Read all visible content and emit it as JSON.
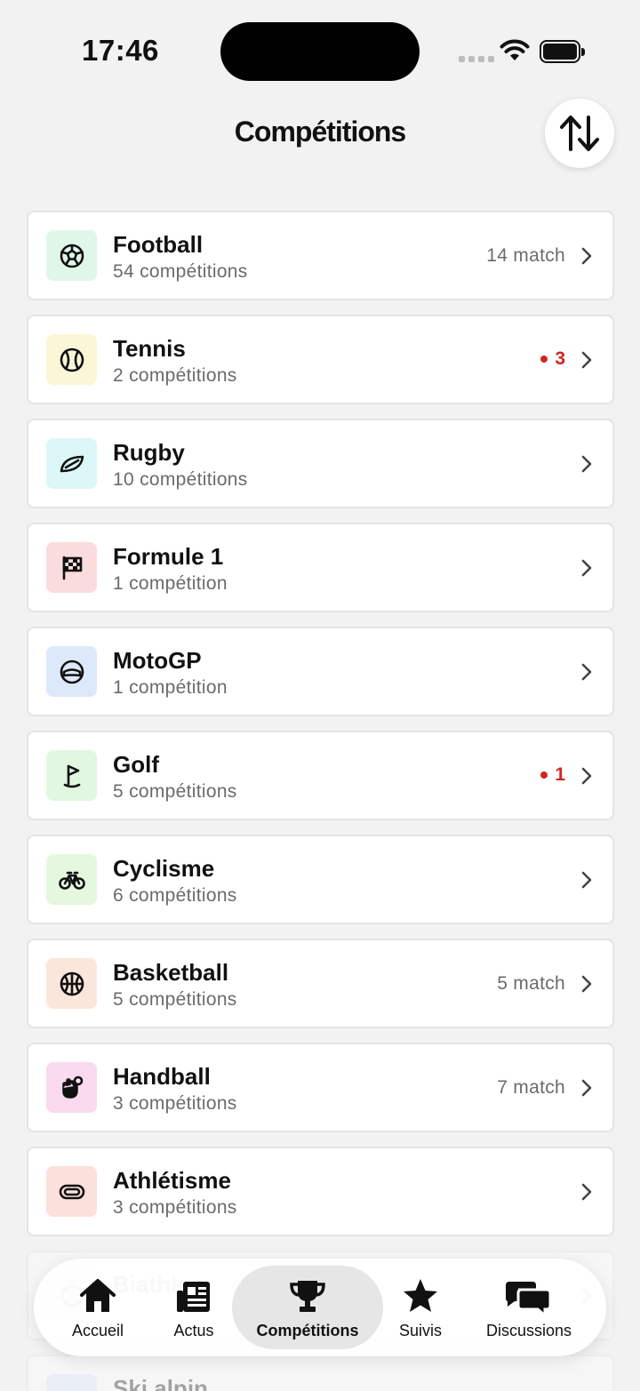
{
  "status_bar": {
    "time": "17:46"
  },
  "header": {
    "title": "Compétitions"
  },
  "competitions": [
    {
      "name": "Football",
      "subtitle": "54 compétitions",
      "right": "14 match",
      "live": null,
      "icon": "soccer-ball-icon",
      "bg": "#dff7e8"
    },
    {
      "name": "Tennis",
      "subtitle": "2 compétitions",
      "right": null,
      "live": "3",
      "icon": "tennis-ball-icon",
      "bg": "#fbf6d6"
    },
    {
      "name": "Rugby",
      "subtitle": "10 compétitions",
      "right": null,
      "live": null,
      "icon": "rugby-ball-icon",
      "bg": "#dcf7f7"
    },
    {
      "name": "Formule 1",
      "subtitle": "1 compétition",
      "right": null,
      "live": null,
      "icon": "checkered-flag-icon",
      "bg": "#fbdcdc"
    },
    {
      "name": "MotoGP",
      "subtitle": "1 compétition",
      "right": null,
      "live": null,
      "icon": "helmet-icon",
      "bg": "#dde9fb"
    },
    {
      "name": "Golf",
      "subtitle": "5 compétitions",
      "right": null,
      "live": "1",
      "icon": "golf-flag-icon",
      "bg": "#e1f7df"
    },
    {
      "name": "Cyclisme",
      "subtitle": "6 compétitions",
      "right": null,
      "live": null,
      "icon": "bicycle-icon",
      "bg": "#e5f8df"
    },
    {
      "name": "Basketball",
      "subtitle": "5 compétitions",
      "right": "5 match",
      "live": null,
      "icon": "basketball-icon",
      "bg": "#fbe6db"
    },
    {
      "name": "Handball",
      "subtitle": "3 compétitions",
      "right": "7 match",
      "live": null,
      "icon": "hand-ball-icon",
      "bg": "#f9daee"
    },
    {
      "name": "Athlétisme",
      "subtitle": "3 compétitions",
      "right": null,
      "live": null,
      "icon": "track-icon",
      "bg": "#fbe0db"
    },
    {
      "name": "Biathlon",
      "subtitle": "",
      "right": null,
      "live": null,
      "icon": "biathlon-icon",
      "bg": "#dde9fb"
    },
    {
      "name": "Ski alpin",
      "subtitle": "",
      "right": null,
      "live": null,
      "icon": "ski-icon",
      "bg": "#dde9fb"
    }
  ],
  "tabbar": {
    "tabs": [
      {
        "label": "Accueil",
        "icon": "home-icon"
      },
      {
        "label": "Actus",
        "icon": "newspaper-icon"
      },
      {
        "label": "Compétitions",
        "icon": "trophy-icon",
        "active": true
      },
      {
        "label": "Suivis",
        "icon": "star-icon"
      },
      {
        "label": "Discussions",
        "icon": "chat-bubbles-icon"
      }
    ]
  },
  "colors": {
    "live_red": "#d32424",
    "text_muted": "#6b6b6b",
    "background": "#f2f2f2"
  }
}
